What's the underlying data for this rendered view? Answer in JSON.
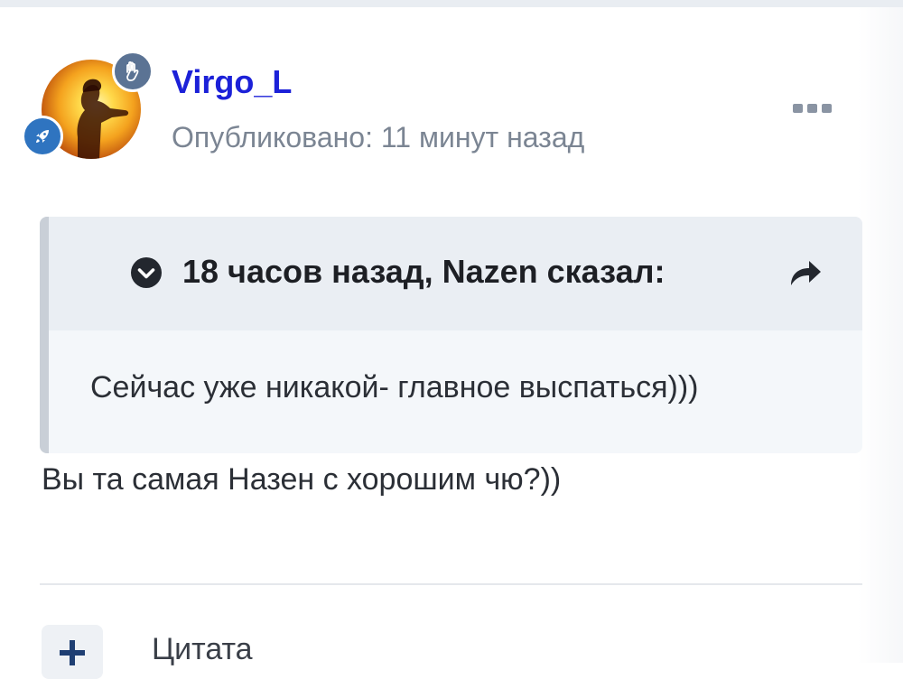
{
  "post": {
    "author": {
      "name": "Virgo_L",
      "published": "Опубликовано: 11 минут назад",
      "avatar": "avatar-silhouette-sunset",
      "badges": [
        "hand-icon",
        "rocket-icon"
      ]
    },
    "menu_icon": "more-dots-icon",
    "quote": {
      "citation": "18 часов назад, Nazen сказал:",
      "text": "Сейчас уже никакой- главное выспаться)))",
      "expand_icon": "chevron-down-circle-icon",
      "share_icon": "share-arrow-icon"
    },
    "body": "Вы та самая Назен с хорошим чю?))"
  },
  "footer": {
    "add_icon": "plus-icon",
    "quote_label": "Цитата"
  },
  "colors": {
    "author_link": "#1c21d8",
    "badge_hand": "#5b7394",
    "badge_rocket": "#2f74c0",
    "quote_header_bg": "#eaeef3",
    "quote_body_bg": "#f4f7fa"
  }
}
